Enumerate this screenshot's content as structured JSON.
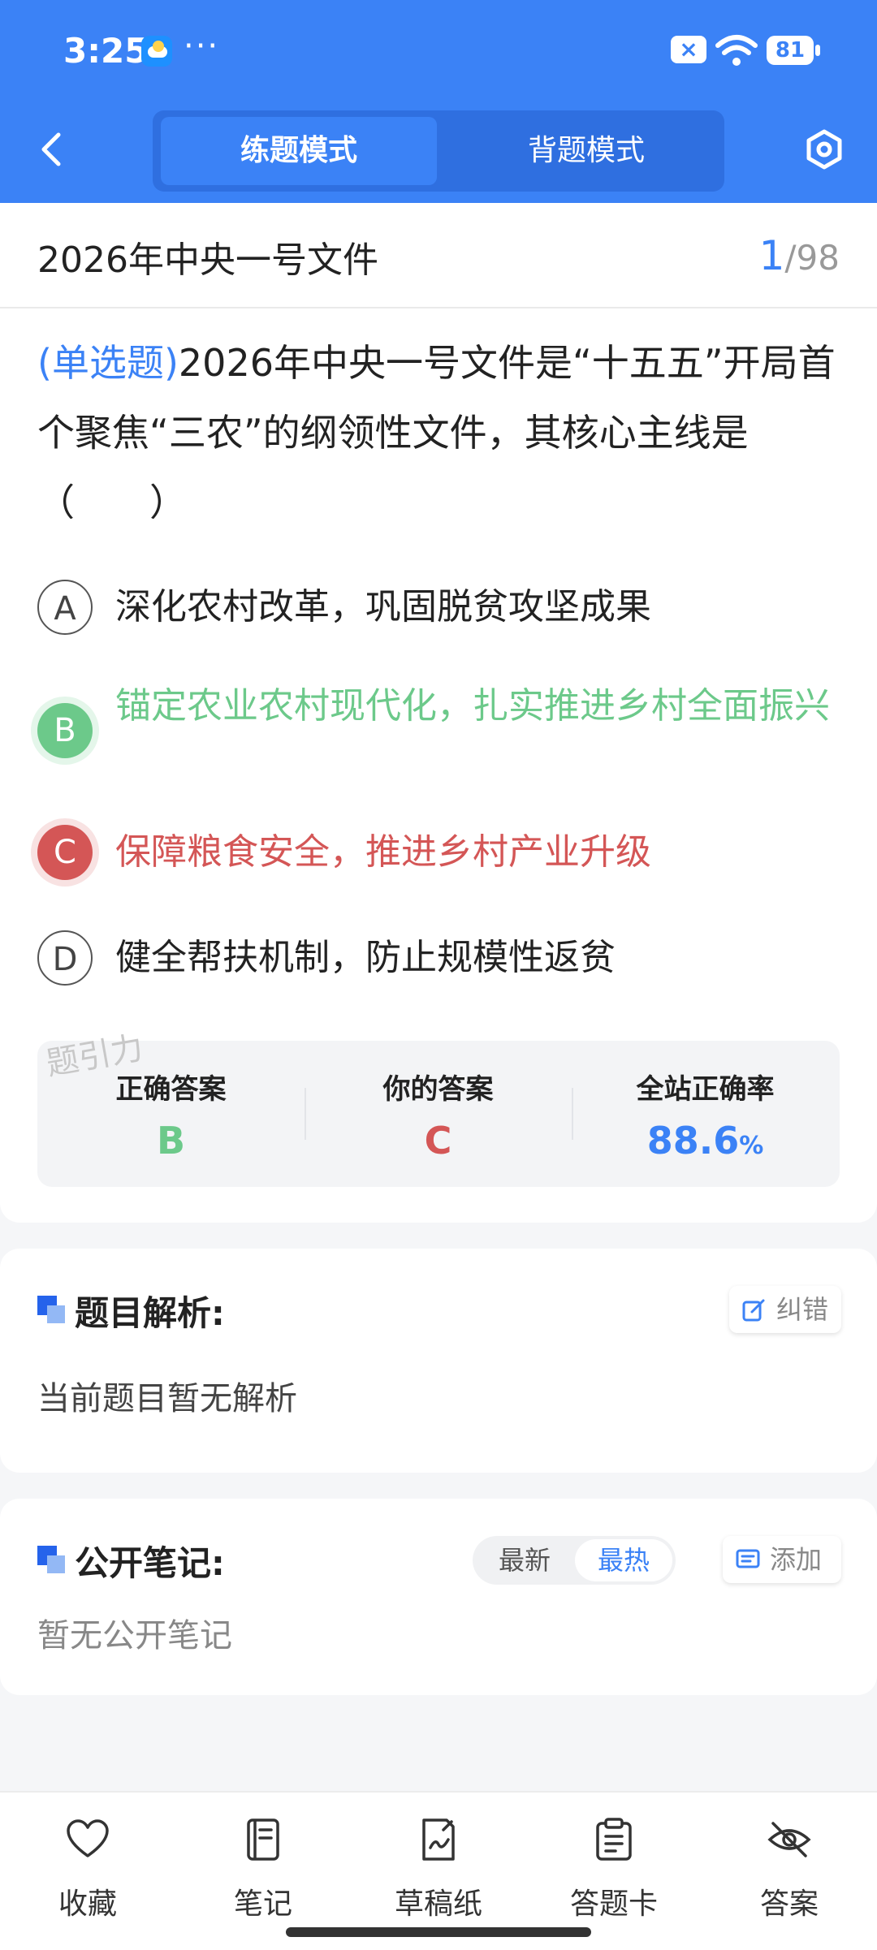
{
  "status_bar": {
    "time": "3:25",
    "dots": "···",
    "battery": "81"
  },
  "header": {
    "tabs": [
      {
        "label": "练题模式",
        "active": true
      },
      {
        "label": "背题模式",
        "active": false
      }
    ],
    "accent_color": "#3b82f6"
  },
  "doc": {
    "title": "2026年中央一号文件",
    "current": "1",
    "separator": "/",
    "total": "98"
  },
  "question": {
    "type": "(单选题)",
    "text": "2026年中央一号文件是“十五五”开局首个聚焦“三农”的纲领性文件，其核心主线是（　　）"
  },
  "options": [
    {
      "letter": "A",
      "text": "深化农村改革，巩固脱贫攻坚成果",
      "state": "normal"
    },
    {
      "letter": "B",
      "text": "锚定农业农村现代化，扎实推进乡村全面振兴",
      "state": "correct"
    },
    {
      "letter": "C",
      "text": "保障粮食安全，推进乡村产业升级",
      "state": "wrong"
    },
    {
      "letter": "D",
      "text": "健全帮扶机制，防止规模性返贫",
      "state": "normal"
    }
  ],
  "watermark": "题引力",
  "result": {
    "correct_label": "正确答案",
    "correct_value": "B",
    "your_label": "你的答案",
    "your_value": "C",
    "rate_label": "全站正确率",
    "rate_value": "88.6",
    "rate_unit": "%"
  },
  "analysis": {
    "title": "题目解析:",
    "report_label": "纠错",
    "content": "当前题目暂无解析"
  },
  "notes": {
    "title": "公开笔记:",
    "sort_latest": "最新",
    "sort_hot": "最热",
    "add_label": "添加",
    "content": "暂无公开笔记"
  },
  "bottom_nav": [
    {
      "label": "收藏",
      "icon": "heart-icon"
    },
    {
      "label": "笔记",
      "icon": "notebook-icon"
    },
    {
      "label": "草稿纸",
      "icon": "draft-pen-icon"
    },
    {
      "label": "答题卡",
      "icon": "clipboard-icon"
    },
    {
      "label": "答案",
      "icon": "eye-off-icon"
    }
  ],
  "colors": {
    "correct": "#6cc98a",
    "wrong": "#d45656",
    "primary": "#3b82f6"
  }
}
